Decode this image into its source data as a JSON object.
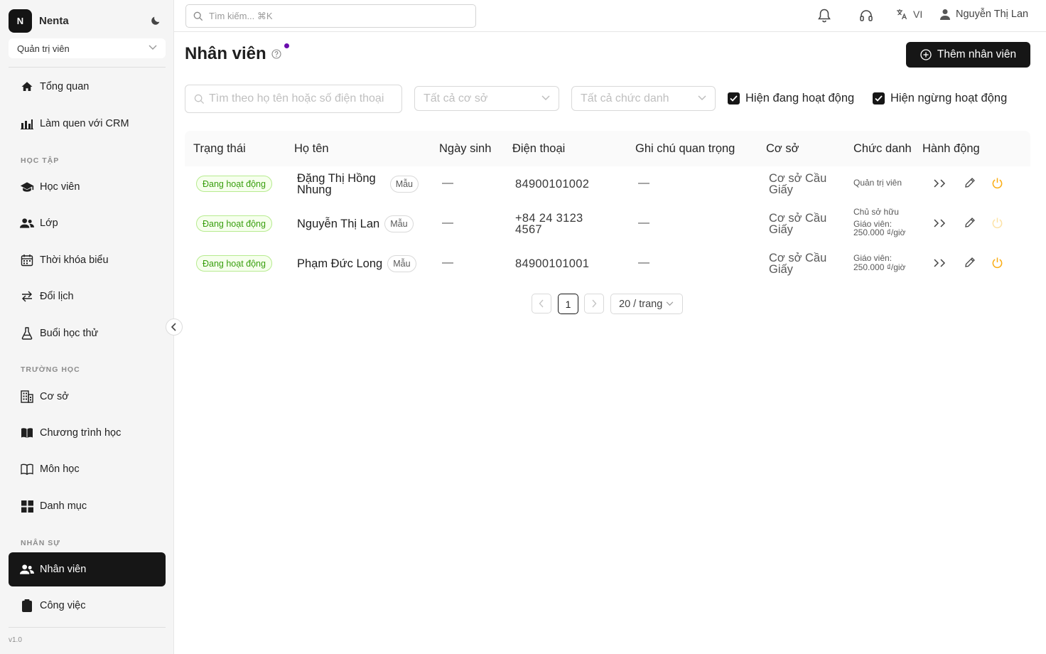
{
  "app": {
    "logo_letter": "N",
    "name": "Nenta",
    "role": "Quản trị viên",
    "version": "v1.0"
  },
  "sidebar": {
    "items_top": [
      {
        "label": "Tổng quan",
        "icon": "home-icon"
      },
      {
        "label": "Làm quen với CRM",
        "icon": "bar-chart-icon"
      }
    ],
    "section_study": "HỌC TẬP",
    "items_study": [
      {
        "label": "Học viên",
        "icon": "graduation-cap-icon"
      },
      {
        "label": "Lớp",
        "icon": "users-icon"
      },
      {
        "label": "Thời khóa biểu",
        "icon": "calendar-icon"
      },
      {
        "label": "Đổi lịch",
        "icon": "swap-icon"
      },
      {
        "label": "Buổi học thử",
        "icon": "flask-icon"
      }
    ],
    "section_school": "TRƯỜNG HỌC",
    "items_school": [
      {
        "label": "Cơ sở",
        "icon": "building-icon"
      },
      {
        "label": "Chương trình học",
        "icon": "book-filled-icon"
      },
      {
        "label": "Môn học",
        "icon": "book-open-icon"
      },
      {
        "label": "Danh mục",
        "icon": "grid-icon"
      }
    ],
    "section_hr": "NHÂN SỰ",
    "items_hr": [
      {
        "label": "Nhân viên",
        "icon": "users-icon",
        "active": true
      },
      {
        "label": "Công việc",
        "icon": "clipboard-icon"
      }
    ]
  },
  "topbar": {
    "search_placeholder": "Tìm kiếm... ⌘K",
    "language": "VI",
    "user_name": "Nguyễn Thị Lan"
  },
  "page": {
    "title": "Nhân viên",
    "add_button": "Thêm nhân viên",
    "filters": {
      "search_placeholder": "Tìm theo họ tên hoặc số điện thoại",
      "site_placeholder": "Tất cả cơ sở",
      "title_placeholder": "Tất cả chức danh",
      "show_active": "Hiện đang hoạt động",
      "show_inactive": "Hiện ngừng hoạt động"
    },
    "table": {
      "columns": [
        "Trạng thái",
        "Họ tên",
        "Ngày sinh",
        "Điện thoại",
        "Ghi chú quan trọng",
        "Cơ sở",
        "Chức danh",
        "Hành động"
      ],
      "rows": [
        {
          "status": "Đang hoạt động",
          "name_line1": "Đặng Thị Hồng",
          "name_line2": "Nhung",
          "tag": "Mẫu",
          "dob": "—",
          "phone_line1": "84900101002",
          "phone_line2": "",
          "note": "—",
          "site_line1": "Cơ sở Cầu",
          "site_line2": "Giấy",
          "role_lines": [
            "Quản trị viên"
          ],
          "power_active": true
        },
        {
          "status": "Đang hoạt động",
          "name_line1": "Nguyễn Thị Lan",
          "name_line2": "",
          "tag": "Mẫu",
          "dob": "—",
          "phone_line1": "+84 24 3123",
          "phone_line2": "4567",
          "note": "—",
          "site_line1": "Cơ sở Cầu",
          "site_line2": "Giấy",
          "role_lines": [
            "Chủ sở hữu",
            "Giáo viên:",
            "250.000 ₫/giờ"
          ],
          "power_active": false
        },
        {
          "status": "Đang hoạt động",
          "name_line1": "Phạm Đức Long",
          "name_line2": "",
          "tag": "Mẫu",
          "dob": "—",
          "phone_line1": "84900101001",
          "phone_line2": "",
          "note": "—",
          "site_line1": "Cơ sở Cầu",
          "site_line2": "Giấy",
          "role_lines": [
            "Giáo viên:",
            "250.000 ₫/giờ"
          ],
          "power_active": true
        }
      ]
    },
    "pagination": {
      "current": "1",
      "page_size": "20 / trang"
    }
  },
  "colors": {
    "accent": "#161616",
    "status_green": "#389e0d",
    "power_orange": "#faad14",
    "notification_dot": "#6a0dad"
  }
}
